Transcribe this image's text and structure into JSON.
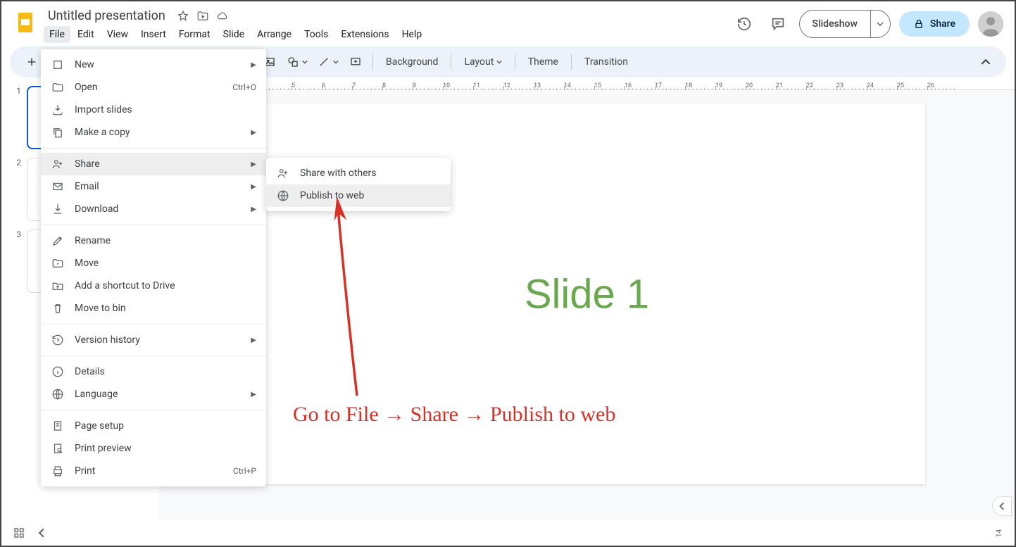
{
  "header": {
    "title": "Untitled presentation",
    "menubar": [
      "File",
      "Edit",
      "View",
      "Insert",
      "Format",
      "Slide",
      "Arrange",
      "Tools",
      "Extensions",
      "Help"
    ],
    "slideshow_label": "Slideshow",
    "share_label": "Share"
  },
  "toolbar": {
    "background": "Background",
    "layout": "Layout",
    "theme": "Theme",
    "transition": "Transition"
  },
  "ruler": {
    "start": 1,
    "interval": 1,
    "spacing": 43,
    "offset": 16
  },
  "thumbnails": [
    {
      "num": "1",
      "selected": true
    },
    {
      "num": "2",
      "selected": false
    },
    {
      "num": "3",
      "selected": false
    }
  ],
  "slide": {
    "text": "Slide 1"
  },
  "file_menu": {
    "sections": [
      [
        {
          "icon": "new",
          "label": "New",
          "arrow": true
        },
        {
          "icon": "open",
          "label": "Open",
          "shortcut": "Ctrl+O"
        },
        {
          "icon": "import",
          "label": "Import slides"
        },
        {
          "icon": "copy",
          "label": "Make a copy",
          "arrow": true
        }
      ],
      [
        {
          "icon": "share",
          "label": "Share",
          "arrow": true,
          "highlight": true
        },
        {
          "icon": "email",
          "label": "Email",
          "arrow": true
        },
        {
          "icon": "download",
          "label": "Download",
          "arrow": true
        }
      ],
      [
        {
          "icon": "rename",
          "label": "Rename"
        },
        {
          "icon": "move",
          "label": "Move"
        },
        {
          "icon": "shortcut",
          "label": "Add a shortcut to Drive"
        },
        {
          "icon": "bin",
          "label": "Move to bin"
        }
      ],
      [
        {
          "icon": "history",
          "label": "Version history",
          "arrow": true
        }
      ],
      [
        {
          "icon": "details",
          "label": "Details"
        },
        {
          "icon": "language",
          "label": "Language",
          "arrow": true
        }
      ],
      [
        {
          "icon": "pagesetup",
          "label": "Page setup"
        },
        {
          "icon": "printpreview",
          "label": "Print preview"
        },
        {
          "icon": "print",
          "label": "Print",
          "shortcut": "Ctrl+P"
        }
      ]
    ]
  },
  "share_submenu": [
    {
      "icon": "sharewith",
      "label": "Share with others"
    },
    {
      "icon": "publish",
      "label": "Publish to web",
      "highlight": true
    }
  ],
  "annotation": {
    "text": "Go to File → Share → Publish to web"
  },
  "bottom": {
    "zoom": "14"
  }
}
